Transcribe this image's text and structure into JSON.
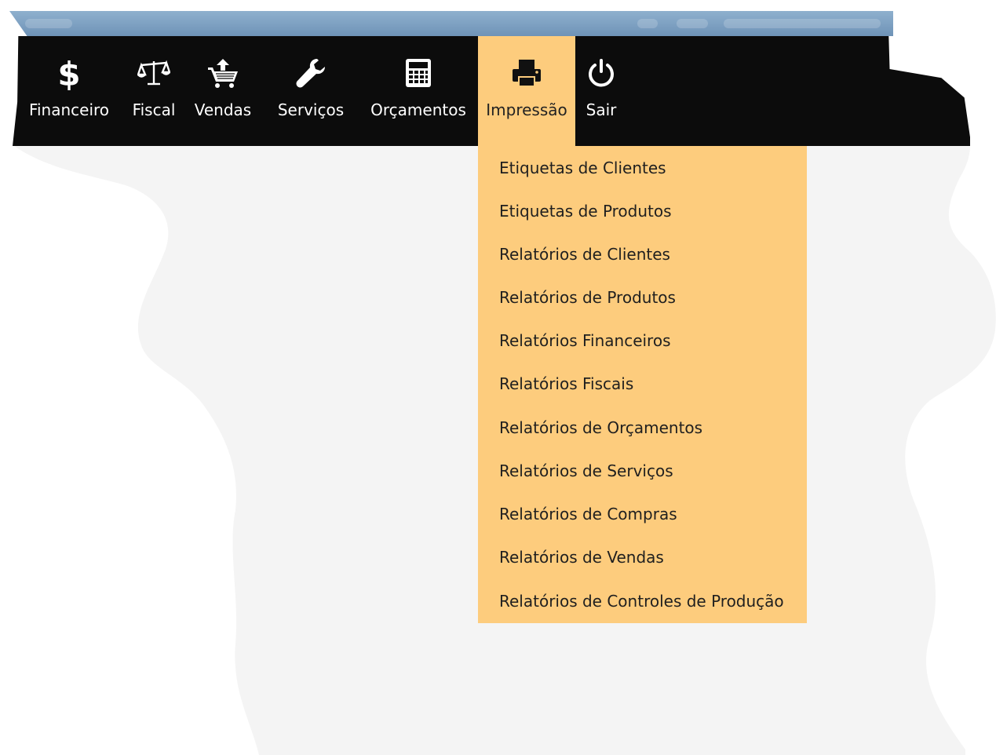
{
  "colors": {
    "menubar": "#0c0c0c",
    "accent": "#fdcc7d",
    "backdrop": "#f5f5f5",
    "titlebar": "#7b9ec2"
  },
  "menu": {
    "items": [
      {
        "label": "Financeiro",
        "icon": "dollar-icon"
      },
      {
        "label": "Fiscal",
        "icon": "balance-scale-icon"
      },
      {
        "label": "Vendas",
        "icon": "shopping-basket-icon"
      },
      {
        "label": "Serviços",
        "icon": "wrench-icon"
      },
      {
        "label": "Orçamentos",
        "icon": "calculator-icon"
      },
      {
        "label": "Impressão",
        "icon": "printer-icon",
        "active": true
      },
      {
        "label": "Sair",
        "icon": "power-icon"
      }
    ]
  },
  "dropdown": {
    "items": [
      "Etiquetas de Clientes",
      "Etiquetas de Produtos",
      "Relatórios de Clientes",
      "Relatórios de Produtos",
      "Relatórios Financeiros",
      "Relatórios Fiscais",
      "Relatórios de Orçamentos",
      "Relatórios de Serviços",
      "Relatórios de Compras",
      "Relatórios de Vendas",
      "Relatórios de Controles de Produção"
    ]
  }
}
